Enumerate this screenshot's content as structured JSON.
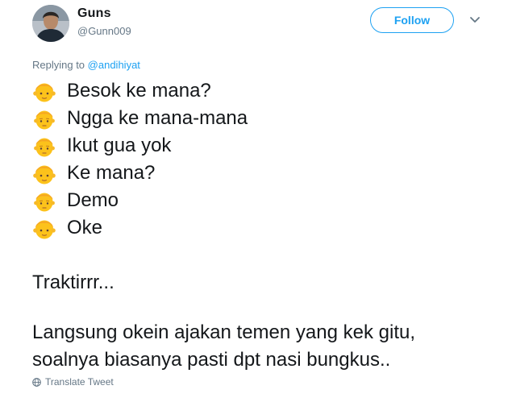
{
  "tweet": {
    "author_name": "Guns",
    "author_handle": "@Gunn009",
    "follow_label": "Follow",
    "replying_prefix": "Replying to",
    "replying_to": "@andihiyat",
    "lines": [
      {
        "emoji": "boy-face-icon",
        "text": "Besok ke mana?"
      },
      {
        "emoji": "man-face-icon",
        "text": "Ngga ke mana-mana"
      },
      {
        "emoji": "man-face-icon",
        "text": "Ikut gua yok"
      },
      {
        "emoji": "boy-face-icon",
        "text": "Ke mana?"
      },
      {
        "emoji": "man-face-icon",
        "text": "Demo"
      },
      {
        "emoji": "boy-face-icon",
        "text": "Oke"
      }
    ],
    "paragraph1": "Traktirrr...",
    "paragraph2_line1": "Langsung okein ajakan temen yang kek gitu,",
    "paragraph2_line2": "soalnya biasanya pasti dpt nasi bungkus..",
    "translate_label": "Translate Tweet"
  },
  "colors": {
    "accent": "#1da1f2",
    "secondary_text": "#657786",
    "primary_text": "#14171a",
    "emoji_skin": "#fcc21b",
    "emoji_hair": "#f5a623"
  }
}
